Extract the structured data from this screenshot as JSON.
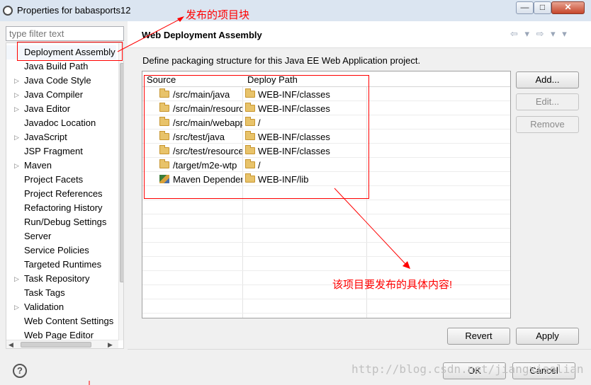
{
  "window": {
    "title": "Properties for babasports12",
    "min_glyph": "—",
    "max_glyph": "□",
    "close_glyph": "✕"
  },
  "left": {
    "filter_placeholder": "type filter text",
    "items": [
      {
        "label": "Deployment Assembly",
        "arrow": "",
        "selected": true
      },
      {
        "label": "Java Build Path",
        "arrow": ""
      },
      {
        "label": "Java Code Style",
        "arrow": "▷"
      },
      {
        "label": "Java Compiler",
        "arrow": "▷"
      },
      {
        "label": "Java Editor",
        "arrow": "▷"
      },
      {
        "label": "Javadoc Location",
        "arrow": ""
      },
      {
        "label": "JavaScript",
        "arrow": "▷"
      },
      {
        "label": "JSP Fragment",
        "arrow": ""
      },
      {
        "label": "Maven",
        "arrow": "▷"
      },
      {
        "label": "Project Facets",
        "arrow": ""
      },
      {
        "label": "Project References",
        "arrow": ""
      },
      {
        "label": "Refactoring History",
        "arrow": ""
      },
      {
        "label": "Run/Debug Settings",
        "arrow": ""
      },
      {
        "label": "Server",
        "arrow": ""
      },
      {
        "label": "Service Policies",
        "arrow": ""
      },
      {
        "label": "Targeted Runtimes",
        "arrow": ""
      },
      {
        "label": "Task Repository",
        "arrow": "▷"
      },
      {
        "label": "Task Tags",
        "arrow": ""
      },
      {
        "label": "Validation",
        "arrow": "▷"
      },
      {
        "label": "Web Content Settings",
        "arrow": ""
      },
      {
        "label": "Web Page Editor",
        "arrow": ""
      }
    ]
  },
  "right": {
    "page_title": "Web Deployment Assembly",
    "nav_glyphs": "⇦ ▾ ⇨ ▾ ▾",
    "description": "Define packaging structure for this Java EE Web Application project.",
    "table": {
      "headers": [
        "Source",
        "Deploy Path"
      ],
      "rows": [
        {
          "source": "/src/main/java",
          "path": "WEB-INF/classes",
          "icon": "folder-icon"
        },
        {
          "source": "/src/main/resources",
          "path": "WEB-INF/classes",
          "icon": "folder-icon"
        },
        {
          "source": "/src/main/webapp",
          "path": "/",
          "icon": "folder-icon"
        },
        {
          "source": "/src/test/java",
          "path": "WEB-INF/classes",
          "icon": "folder-icon"
        },
        {
          "source": "/src/test/resources",
          "path": "WEB-INF/classes",
          "icon": "folder-icon"
        },
        {
          "source": "/target/m2e-wtp",
          "path": "/",
          "icon": "folder-icon"
        },
        {
          "source": "Maven Dependencies",
          "path": "WEB-INF/lib",
          "icon": "maven-library-icon"
        }
      ]
    },
    "buttons": {
      "add": "Add...",
      "edit": "Edit...",
      "remove": "Remove",
      "revert": "Revert",
      "apply": "Apply"
    }
  },
  "footer": {
    "help": "?",
    "ok": "OK",
    "cancel": "Cancel"
  },
  "annotations": {
    "top": "发布的项目块",
    "middle": "该项目要发布的具体内容!"
  },
  "watermark": "http://blog.csdn.net/jiangxiaolian",
  "colors": {
    "annotation": "#ff0000",
    "titlebar": "#dbe5f1"
  }
}
